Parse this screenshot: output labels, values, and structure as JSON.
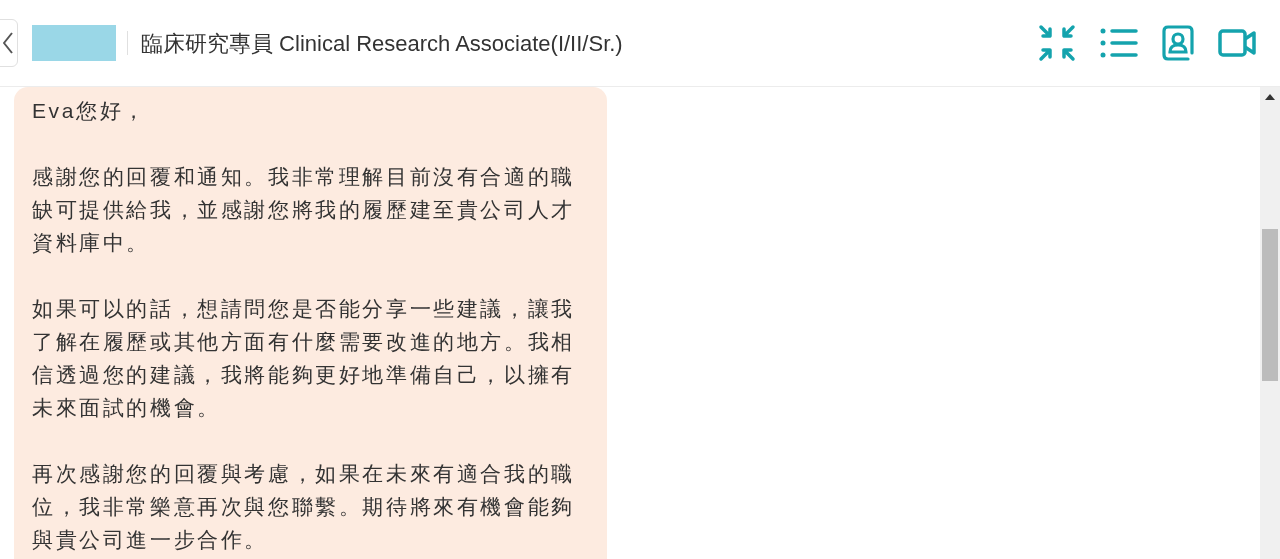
{
  "header": {
    "title": "臨床研究專員 Clinical Research Associate(I/II/Sr.)"
  },
  "message": {
    "paragraphs": [
      "Eva您好，",
      "感謝您的回覆和通知。我非常理解目前沒有合適的職缺可提供給我，並感謝您將我的履歷建至貴公司人才資料庫中。",
      "如果可以的話，想請問您是否能分享一些建議，讓我了解在履歷或其他方面有什麼需要改進的地方。我相信透過您的建議，我將能夠更好地準備自己，以擁有未來面試的機會。",
      "再次感謝您的回覆與考慮，如果在未來有適合我的職位，我非常樂意再次與您聯繫。期待將來有機會能夠與貴公司進一步合作。"
    ]
  }
}
